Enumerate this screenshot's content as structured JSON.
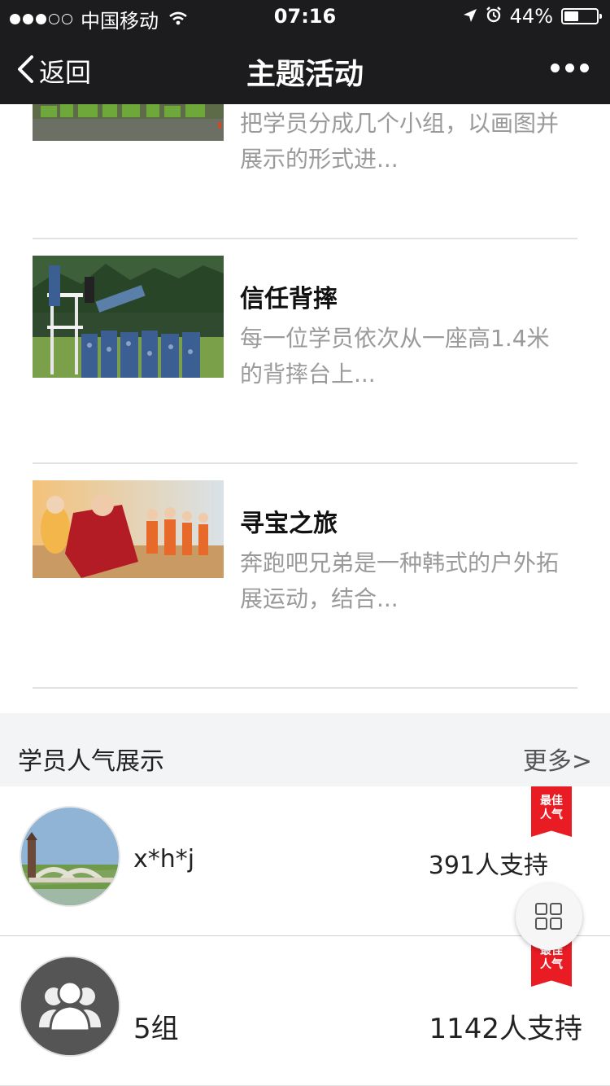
{
  "status_bar": {
    "carrier": "中国移动",
    "time": "07:16",
    "battery_text": "44%",
    "battery_level": 0.44,
    "icons": [
      "signal-dots",
      "wifi-icon",
      "location-icon",
      "alarm-icon",
      "battery-icon"
    ]
  },
  "nav": {
    "back_label": "返回",
    "title": "主题活动",
    "more_icon": "more-dots-icon"
  },
  "articles": [
    {
      "title": "",
      "summary": "把学员分成几个小组，以画图并展示的形式进..."
    },
    {
      "title": "信任背摔",
      "summary": "每一位学员依次从一座高1.4米的背摔台上..."
    },
    {
      "title": "寻宝之旅",
      "summary": "奔跑吧兄弟是一种韩式的户外拓展运动，结合..."
    }
  ],
  "popularity": {
    "title": "学员人气展示",
    "more": "更多>",
    "badge_line1": "最佳",
    "badge_line2": "人气",
    "users": [
      {
        "name": "x*h*j",
        "support": "391人支持"
      },
      {
        "name": "5组",
        "support": "1142人支持"
      }
    ]
  },
  "colors": {
    "nav_bg": "#1c1c1e",
    "ribbon": "#e91c24",
    "section_bg": "#f3f4f6"
  }
}
